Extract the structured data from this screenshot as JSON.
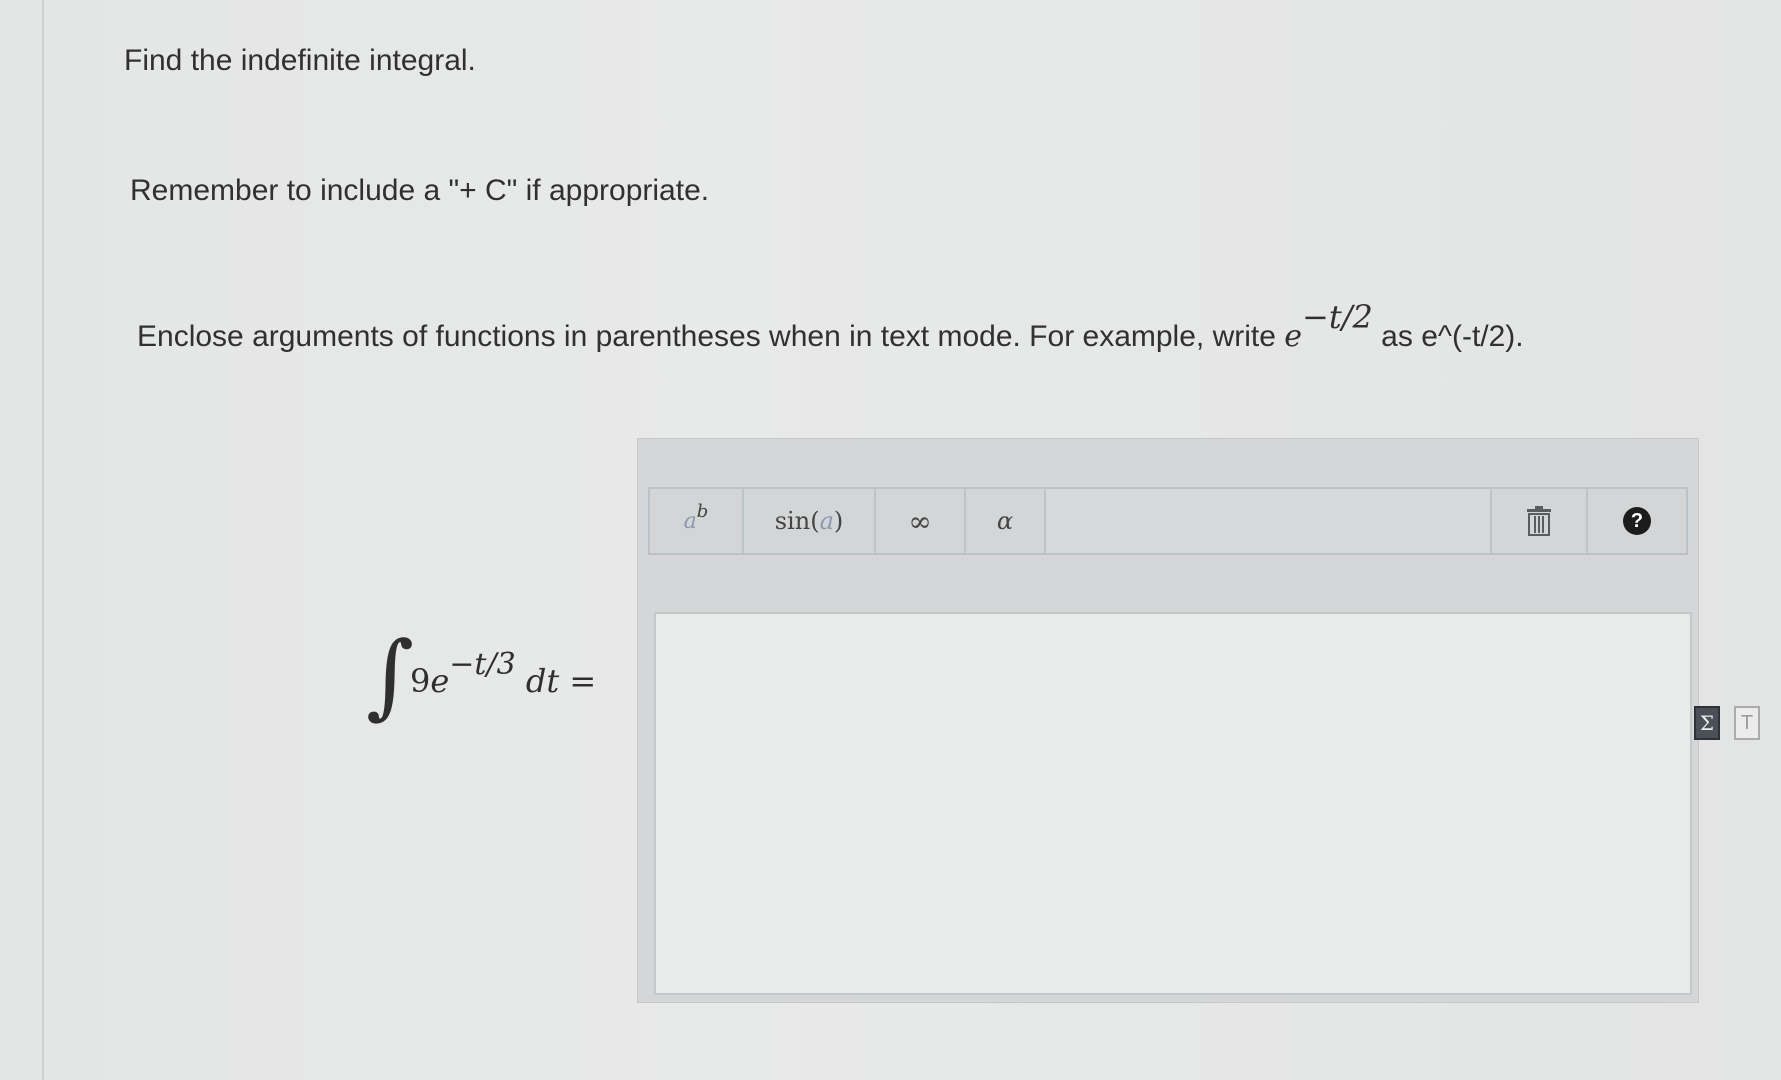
{
  "instructions": {
    "title": "Find the indefinite integral.",
    "reminder": "Remember to include a \"+ C\" if appropriate.",
    "enclose_before": "Enclose arguments of functions in parentheses when in text mode. For example, write ",
    "enclose_base": "e",
    "enclose_exponent": "−t/2",
    "enclose_after": " as e^(-t/2)."
  },
  "problem": {
    "integral_sign": "∫",
    "coefficient": "9",
    "base": "e",
    "exponent": "−t/3",
    "differential": "dt =",
    "full_text": "∫ 9e^(−t/3) dt ="
  },
  "toolbar": {
    "exponent_base": "a",
    "exponent_power": "b",
    "sin_label": "sin",
    "sin_open": " (",
    "sin_arg": "a",
    "sin_close": ")",
    "infinity_label": "∞",
    "alpha_label": "α",
    "trash_icon": "trash-icon",
    "help_label": "?"
  },
  "side_icons": {
    "sigma_label": "Σ",
    "text_mode_label": "T"
  },
  "answer": {
    "value": ""
  }
}
